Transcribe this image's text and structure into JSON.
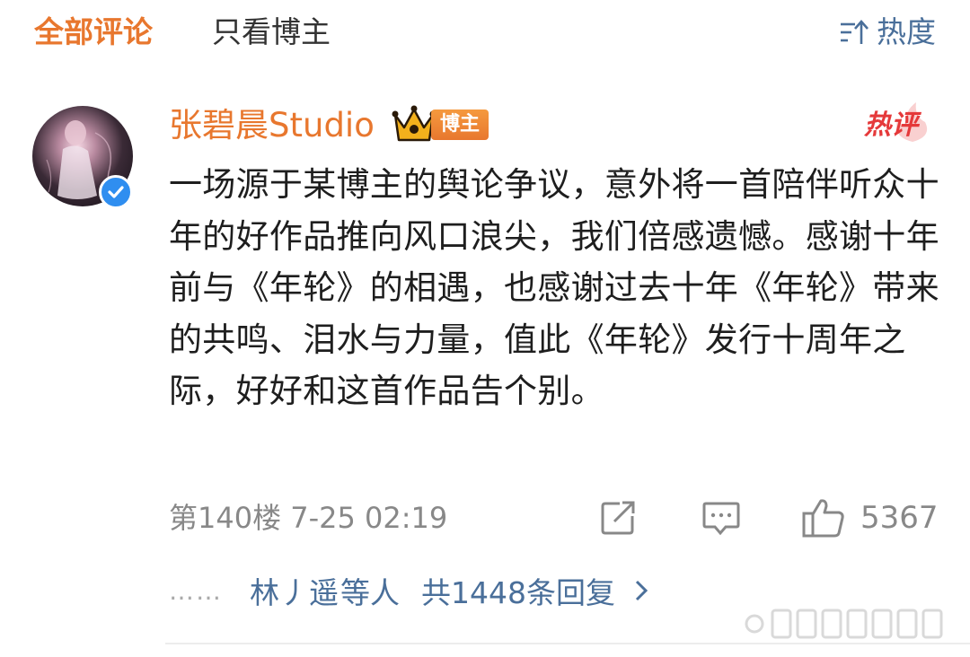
{
  "tabs": {
    "all_comments": "全部评论",
    "owner_only": "只看博主",
    "sort_label": "热度",
    "sort_icon": "sort-icon"
  },
  "comment": {
    "username": "张碧晨Studio",
    "owner_badge": "博主",
    "hot_badge": "热评",
    "content": "一场源于某博主的舆论争议，意外将一首陪伴听众十年的好作品推向风口浪尖，我们倍感遗憾。感谢十年前与《年轮》的相遇，也感谢过去十年《年轮》带来的共鸣、泪水与力量，值此《年轮》发行十周年之际，好好和这首作品告个别。",
    "floor_time": "第140楼 7-25 02:19",
    "like_count": "5367"
  },
  "replies": {
    "dots": "……",
    "reply_user": "林丿遥",
    "suffix": "等人",
    "count_text": "共1448条回复"
  },
  "colors": {
    "accent": "#e8772e",
    "link": "#4a6f9a",
    "meta": "#888888",
    "hot": "#e5393a",
    "verified": "#2f8ef0"
  }
}
